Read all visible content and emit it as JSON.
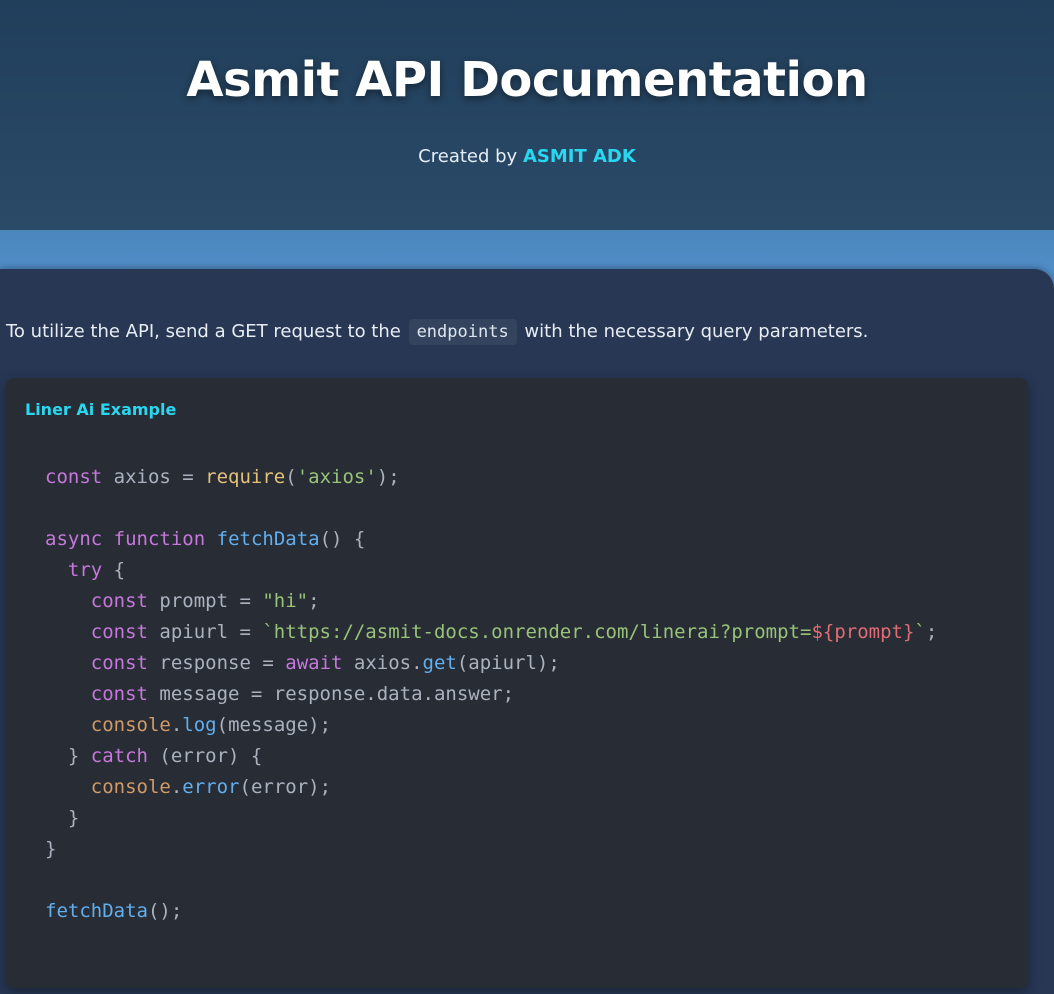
{
  "header": {
    "title": "Asmit API Documentation",
    "created_by_prefix": "Created by ",
    "author": "ASMIT ADK"
  },
  "intro": {
    "text_before": "To utilize the API, send a GET request to the ",
    "code": "endpoints",
    "text_after": " with the necessary query parameters."
  },
  "code_example": {
    "title": "Liner Ai Example",
    "lines": [
      [
        {
          "t": "const",
          "c": "kw"
        },
        {
          "t": " axios = ",
          "c": "pl"
        },
        {
          "t": "require",
          "c": "req"
        },
        {
          "t": "(",
          "c": "pl"
        },
        {
          "t": "'axios'",
          "c": "str"
        },
        {
          "t": ");",
          "c": "pl"
        }
      ],
      [],
      [
        {
          "t": "async",
          "c": "kw"
        },
        {
          "t": " ",
          "c": "pl"
        },
        {
          "t": "function",
          "c": "kw"
        },
        {
          "t": " ",
          "c": "pl"
        },
        {
          "t": "fetchData",
          "c": "fn"
        },
        {
          "t": "() {",
          "c": "pl"
        }
      ],
      [
        {
          "t": "  ",
          "c": "pl"
        },
        {
          "t": "try",
          "c": "kw"
        },
        {
          "t": " {",
          "c": "pl"
        }
      ],
      [
        {
          "t": "    ",
          "c": "pl"
        },
        {
          "t": "const",
          "c": "kw"
        },
        {
          "t": " prompt = ",
          "c": "pl"
        },
        {
          "t": "\"hi\"",
          "c": "str"
        },
        {
          "t": ";",
          "c": "pl"
        }
      ],
      [
        {
          "t": "    ",
          "c": "pl"
        },
        {
          "t": "const",
          "c": "kw"
        },
        {
          "t": " apiurl = ",
          "c": "pl"
        },
        {
          "t": "`https://asmit-docs.onrender.com/linerai?prompt=",
          "c": "str"
        },
        {
          "t": "${prompt}",
          "c": "tpl"
        },
        {
          "t": "`",
          "c": "str"
        },
        {
          "t": ";",
          "c": "pl"
        }
      ],
      [
        {
          "t": "    ",
          "c": "pl"
        },
        {
          "t": "const",
          "c": "kw"
        },
        {
          "t": " response = ",
          "c": "pl"
        },
        {
          "t": "await",
          "c": "kw"
        },
        {
          "t": " axios.",
          "c": "pl"
        },
        {
          "t": "get",
          "c": "fn"
        },
        {
          "t": "(apiurl);",
          "c": "pl"
        }
      ],
      [
        {
          "t": "    ",
          "c": "pl"
        },
        {
          "t": "const",
          "c": "kw"
        },
        {
          "t": " message = response.data.answer;",
          "c": "pl"
        }
      ],
      [
        {
          "t": "    ",
          "c": "pl"
        },
        {
          "t": "console",
          "c": "obj"
        },
        {
          "t": ".",
          "c": "pl"
        },
        {
          "t": "log",
          "c": "fn"
        },
        {
          "t": "(message);",
          "c": "pl"
        }
      ],
      [
        {
          "t": "  } ",
          "c": "pl"
        },
        {
          "t": "catch",
          "c": "kw"
        },
        {
          "t": " (error) {",
          "c": "pl"
        }
      ],
      [
        {
          "t": "    ",
          "c": "pl"
        },
        {
          "t": "console",
          "c": "obj"
        },
        {
          "t": ".",
          "c": "pl"
        },
        {
          "t": "error",
          "c": "fn"
        },
        {
          "t": "(error);",
          "c": "pl"
        }
      ],
      [
        {
          "t": "  }",
          "c": "pl"
        }
      ],
      [
        {
          "t": "}",
          "c": "pl"
        }
      ],
      [],
      [
        {
          "t": "fetchData",
          "c": "fn"
        },
        {
          "t": "();",
          "c": "pl"
        }
      ]
    ]
  }
}
